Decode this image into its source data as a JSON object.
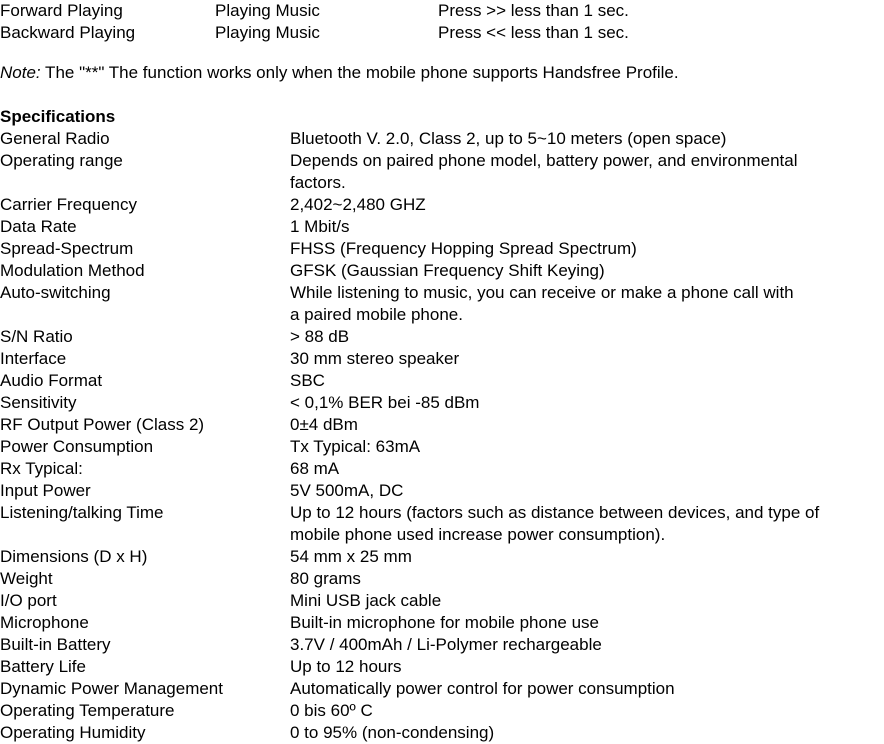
{
  "function_table": {
    "rows": [
      {
        "function": "Forward Playing",
        "status": "Playing Music",
        "operation": "Press >> less than 1 sec."
      },
      {
        "function": "Backward Playing",
        "status": "Playing Music",
        "operation": "Press << less than 1 sec."
      }
    ]
  },
  "note": {
    "label": "Note:",
    "text": " The \"**\" The function works only when the mobile phone supports Handsfree Profile."
  },
  "specifications": {
    "heading": "Specifications",
    "rows": [
      {
        "label": "General Radio",
        "lines": [
          "Bluetooth V. 2.0, Class 2, up to 5~10 meters (open space)"
        ]
      },
      {
        "label": "Operating range",
        "lines": [
          "Depends on paired phone model, battery power, and environmental",
          "factors."
        ]
      },
      {
        "label": "Carrier Frequency",
        "lines": [
          "2,402~2,480 GHZ"
        ]
      },
      {
        "label": "Data Rate",
        "lines": [
          "1 Mbit/s"
        ]
      },
      {
        "label": "Spread-Spectrum",
        "lines": [
          "FHSS (Frequency Hopping Spread Spectrum)"
        ]
      },
      {
        "label": "Modulation Method",
        "lines": [
          "GFSK (Gaussian Frequency Shift Keying)"
        ]
      },
      {
        "label": "Auto-switching",
        "lines": [
          "While listening to music, you can receive or make a phone call with",
          "a paired mobile phone."
        ]
      },
      {
        "label": "S/N Ratio",
        "lines": [
          "> 88 dB"
        ]
      },
      {
        "label": "Interface",
        "lines": [
          "30 mm stereo speaker"
        ]
      },
      {
        "label": "Audio Format",
        "lines": [
          "SBC"
        ]
      },
      {
        "label": "Sensitivity",
        "lines": [
          "< 0,1% BER bei -85 dBm"
        ]
      },
      {
        "label": "RF Output Power (Class 2)",
        "lines": [
          "0±4 dBm"
        ]
      },
      {
        "label": "Power Consumption",
        "lines": [
          "Tx Typical: 63mA"
        ]
      },
      {
        "label": "Rx Typical:",
        "lines": [
          "68 mA"
        ]
      },
      {
        "label": "Input Power",
        "lines": [
          "5V 500mA, DC"
        ]
      },
      {
        "label": "Listening/talking Time",
        "lines": [
          "Up to 12 hours (factors such as distance between devices, and type of",
          "mobile phone used increase power consumption)."
        ]
      },
      {
        "label": "Dimensions (D x H)",
        "lines": [
          "54 mm x 25 mm"
        ]
      },
      {
        "label": "Weight",
        "lines": [
          "80 grams"
        ]
      },
      {
        "label": "I/O port",
        "lines": [
          "Mini USB jack cable"
        ]
      },
      {
        "label": "Microphone",
        "lines": [
          "Built-in microphone for mobile phone use"
        ]
      },
      {
        "label": "Built-in Battery",
        "lines": [
          "3.7V / 400mAh / Li-Polymer rechargeable"
        ]
      },
      {
        "label": "Battery Life",
        "lines": [
          "Up to 12 hours"
        ]
      },
      {
        "label": "Dynamic Power Management",
        "lines": [
          "Automatically power control for power consumption"
        ]
      },
      {
        "label": "Operating Temperature",
        "lines": [
          "0 bis 60º C"
        ]
      },
      {
        "label": "Operating Humidity",
        "lines": [
          "0 to 95% (non-condensing)"
        ]
      }
    ]
  }
}
